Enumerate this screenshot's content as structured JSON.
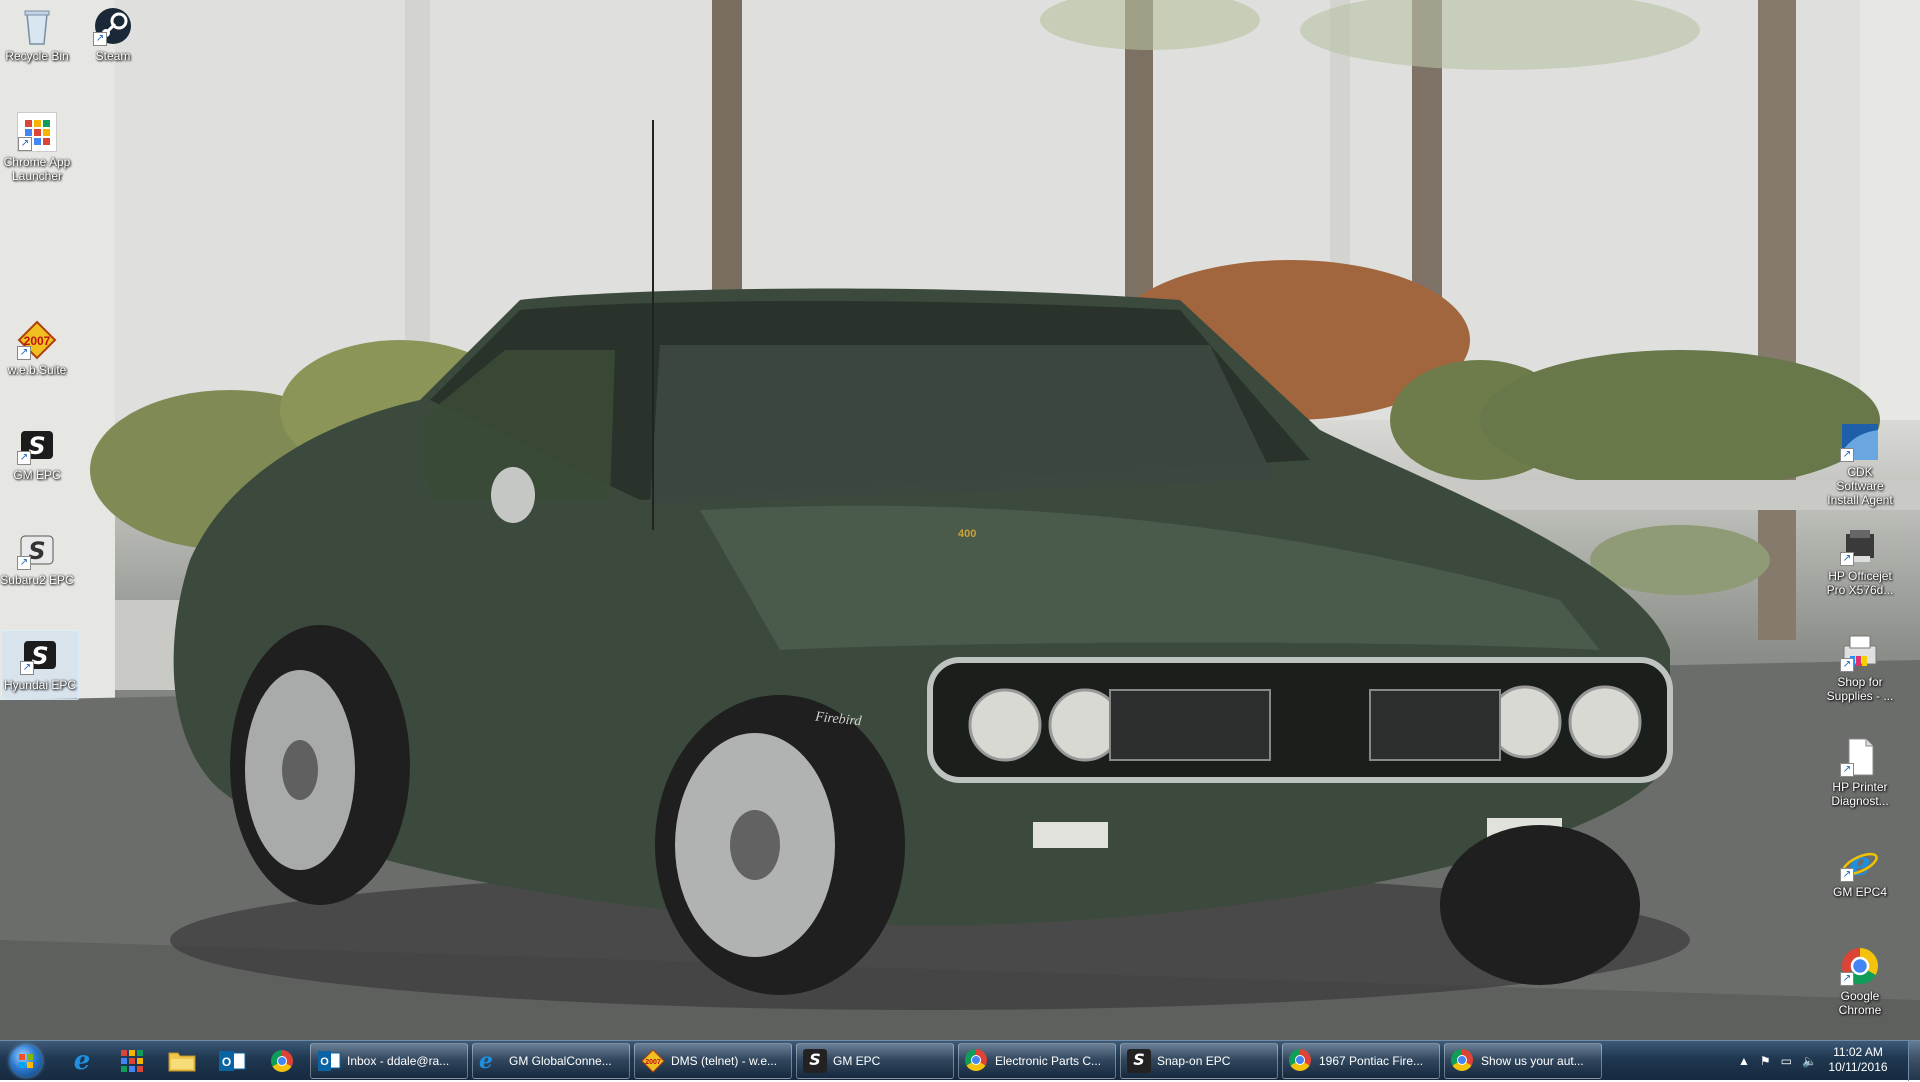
{
  "desktop": {
    "left_icons": [
      {
        "label": "Recycle Bin",
        "icon": "recycle-bin-icon"
      },
      {
        "label": "Steam",
        "icon": "steam-icon"
      },
      {
        "label": "Chrome App Launcher",
        "icon": "app-launcher-icon"
      },
      {
        "label": "w.e.b.Suite",
        "icon": "web-suite-icon"
      },
      {
        "label": "GM EPC",
        "icon": "snapon-epc-icon"
      },
      {
        "label": "Subaru2 EPC",
        "icon": "snapon-epc-icon"
      },
      {
        "label": "Hyundai EPC",
        "icon": "snapon-epc-icon"
      }
    ],
    "right_icons": [
      {
        "label": "CDK Software Install Agent",
        "icon": "cdk-icon"
      },
      {
        "label": "HP Officejet Pro X576d...",
        "icon": "printer-icon"
      },
      {
        "label": "Shop for Supplies - ...",
        "icon": "printer-supplies-icon"
      },
      {
        "label": "HP Printer Diagnost...",
        "icon": "document-icon"
      },
      {
        "label": "GM EPC4",
        "icon": "ie-icon"
      },
      {
        "label": "Google Chrome",
        "icon": "chrome-icon"
      }
    ]
  },
  "wallpaper": {
    "badge": "400",
    "script": "Firebird"
  },
  "taskbar": {
    "pinned": [
      {
        "icon": "internet-explorer-icon"
      },
      {
        "icon": "app-launcher-icon"
      },
      {
        "icon": "file-explorer-icon"
      },
      {
        "icon": "outlook-icon"
      },
      {
        "icon": "chrome-icon"
      }
    ],
    "tasks": [
      {
        "label": "Inbox - ddale@ra...",
        "icon": "outlook-icon"
      },
      {
        "label": "GM GlobalConne...",
        "icon": "internet-explorer-icon"
      },
      {
        "label": "DMS (telnet) - w.e...",
        "icon": "web-suite-icon"
      },
      {
        "label": "GM EPC",
        "icon": "snapon-epc-icon"
      },
      {
        "label": "Electronic Parts C...",
        "icon": "chrome-icon"
      },
      {
        "label": "Snap-on EPC",
        "icon": "snapon-epc-icon"
      },
      {
        "label": "1967 Pontiac Fire...",
        "icon": "chrome-icon"
      },
      {
        "label": "Show us your aut...",
        "icon": "chrome-icon"
      }
    ],
    "clock": {
      "time": "11:02 AM",
      "date": "10/11/2016"
    }
  },
  "colors": {
    "car": "#3b4a3c",
    "taskbar": "#1f3750"
  }
}
